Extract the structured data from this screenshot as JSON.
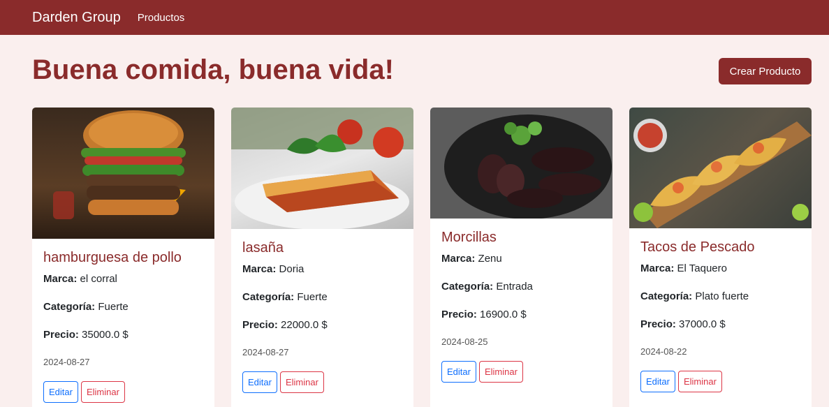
{
  "navbar": {
    "brand": "Darden Group",
    "link": "Productos"
  },
  "header": {
    "title": "Buena comida, buena vida!",
    "create_label": "Crear Producto"
  },
  "labels": {
    "marca": "Marca:",
    "categoria": "Categoría:",
    "precio": "Precio:",
    "edit": "Editar",
    "delete": "Eliminar"
  },
  "products": [
    {
      "name": "hamburguesa de pollo",
      "marca": "el corral",
      "categoria": "Fuerte",
      "precio": "35000.0 $",
      "date": "2024-08-27"
    },
    {
      "name": "lasaña",
      "marca": "Doria",
      "categoria": "Fuerte",
      "precio": "22000.0 $",
      "date": "2024-08-27"
    },
    {
      "name": "Morcillas",
      "marca": "Zenu",
      "categoria": "Entrada",
      "precio": "16900.0 $",
      "date": "2024-08-25"
    },
    {
      "name": "Tacos de Pescado",
      "marca": "El Taquero",
      "categoria": "Plato fuerte",
      "precio": "37000.0 $",
      "date": "2024-08-22"
    }
  ],
  "colors": {
    "brand": "#8a2b2b",
    "background": "#faefee",
    "edit": "#0d6efd",
    "delete": "#dc3545"
  }
}
